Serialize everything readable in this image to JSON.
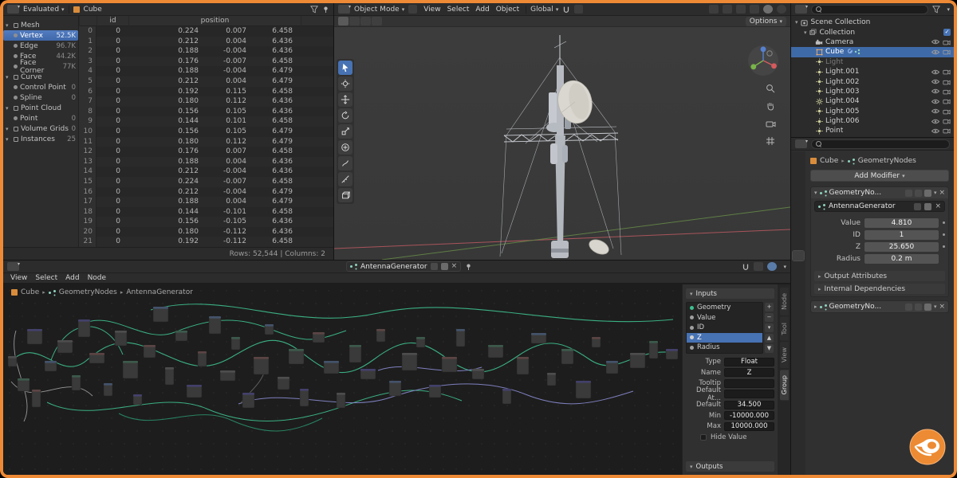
{
  "colors": {
    "accent_orange": "#ee8a35",
    "select_blue": "#4772b3",
    "wire_green": "#3ec08f",
    "wire_purple": "#8a8bd0"
  },
  "spreadsheet": {
    "header": {
      "dataset_label": "Evaluated",
      "object_label": "Cube"
    },
    "sidebar": [
      {
        "label": "Mesh",
        "count": "",
        "kind": "group"
      },
      {
        "label": "Vertex",
        "count": "52.5K",
        "kind": "item",
        "selected": true
      },
      {
        "label": "Edge",
        "count": "96.7K",
        "kind": "item"
      },
      {
        "label": "Face",
        "count": "44.2K",
        "kind": "item"
      },
      {
        "label": "Face Corner",
        "count": "77K",
        "kind": "item"
      },
      {
        "label": "Curve",
        "count": "",
        "kind": "group"
      },
      {
        "label": "Control Point",
        "count": "0",
        "kind": "item"
      },
      {
        "label": "Spline",
        "count": "0",
        "kind": "item"
      },
      {
        "label": "Point Cloud",
        "count": "",
        "kind": "group"
      },
      {
        "label": "Point",
        "count": "0",
        "kind": "item"
      },
      {
        "label": "Volume Grids",
        "count": "0",
        "kind": "group"
      },
      {
        "label": "Instances",
        "count": "25",
        "kind": "group"
      }
    ],
    "table": {
      "id_header": "id",
      "position_header": "position",
      "rows": [
        [
          "0",
          "0",
          "0.224",
          "0.007",
          "6.458"
        ],
        [
          "1",
          "0",
          "0.212",
          "0.004",
          "6.436"
        ],
        [
          "2",
          "0",
          "0.188",
          "-0.004",
          "6.436"
        ],
        [
          "3",
          "0",
          "0.176",
          "-0.007",
          "6.458"
        ],
        [
          "4",
          "0",
          "0.188",
          "-0.004",
          "6.479"
        ],
        [
          "5",
          "0",
          "0.212",
          "0.004",
          "6.479"
        ],
        [
          "6",
          "0",
          "0.192",
          "0.115",
          "6.458"
        ],
        [
          "7",
          "0",
          "0.180",
          "0.112",
          "6.436"
        ],
        [
          "8",
          "0",
          "0.156",
          "0.105",
          "6.436"
        ],
        [
          "9",
          "0",
          "0.144",
          "0.101",
          "6.458"
        ],
        [
          "10",
          "0",
          "0.156",
          "0.105",
          "6.479"
        ],
        [
          "11",
          "0",
          "0.180",
          "0.112",
          "6.479"
        ],
        [
          "12",
          "0",
          "0.176",
          "0.007",
          "6.458"
        ],
        [
          "13",
          "0",
          "0.188",
          "0.004",
          "6.436"
        ],
        [
          "14",
          "0",
          "0.212",
          "-0.004",
          "6.436"
        ],
        [
          "15",
          "0",
          "0.224",
          "-0.007",
          "6.458"
        ],
        [
          "16",
          "0",
          "0.212",
          "-0.004",
          "6.479"
        ],
        [
          "17",
          "0",
          "0.188",
          "0.004",
          "6.479"
        ],
        [
          "18",
          "0",
          "0.144",
          "-0.101",
          "6.458"
        ],
        [
          "19",
          "0",
          "0.156",
          "-0.105",
          "6.436"
        ],
        [
          "20",
          "0",
          "0.180",
          "-0.112",
          "6.436"
        ],
        [
          "21",
          "0",
          "0.192",
          "-0.112",
          "6.458"
        ]
      ]
    },
    "status": "Rows: 52,544  |  Columns: 2"
  },
  "viewport": {
    "mode": "Object Mode",
    "menus": [
      {
        "label": "View"
      },
      {
        "label": "Select"
      },
      {
        "label": "Add"
      },
      {
        "label": "Object"
      }
    ],
    "orientation": "Global",
    "options_label": "Options"
  },
  "outliner": {
    "rows": [
      {
        "label": "Scene Collection",
        "kind": "scene",
        "depth": "d0",
        "arrow": true
      },
      {
        "label": "Collection",
        "kind": "collection",
        "depth": "d1",
        "arrow": true,
        "check": true
      },
      {
        "label": "Camera",
        "kind": "camera",
        "depth": "d2",
        "vis": true
      },
      {
        "label": "Cube",
        "kind": "mesh",
        "depth": "d2",
        "vis": true,
        "mods": true,
        "selected": true
      },
      {
        "label": "Light",
        "kind": "light",
        "depth": "d2",
        "dim": true
      },
      {
        "label": "Light.001",
        "kind": "light",
        "depth": "d2",
        "vis": true
      },
      {
        "label": "Light.002",
        "kind": "light",
        "depth": "d2",
        "vis": true
      },
      {
        "label": "Light.003",
        "kind": "light",
        "depth": "d2",
        "vis": true
      },
      {
        "label": "Light.004",
        "kind": "sun",
        "depth": "d2",
        "vis": true
      },
      {
        "label": "Light.005",
        "kind": "light",
        "depth": "d2",
        "vis": true
      },
      {
        "label": "Light.006",
        "kind": "light",
        "depth": "d2",
        "vis": true
      },
      {
        "label": "Point",
        "kind": "light",
        "depth": "d2",
        "vis": true
      }
    ]
  },
  "properties": {
    "breadcrumb": {
      "object": "Cube",
      "modifier": "GeometryNodes"
    },
    "add_modifier_label": "Add Modifier",
    "modifier": {
      "name": "GeometryNo...",
      "node_group": "AntennaGenerator",
      "fields": [
        {
          "label": "Value",
          "value": "4.810",
          "dot": true
        },
        {
          "label": "ID",
          "value": "1",
          "dot": true
        },
        {
          "label": "Z",
          "value": "25.650",
          "dot": true
        },
        {
          "label": "Radius",
          "value": "0.2 m"
        }
      ],
      "sections": [
        {
          "label": "Output Attributes"
        },
        {
          "label": "Internal Dependencies"
        }
      ]
    },
    "modifier2_name": "GeometryNo...",
    "tabs": [
      {
        "name": "tool",
        "color": "#9a9a9a"
      },
      {
        "name": "render",
        "color": "#9a9a9a"
      },
      {
        "name": "output",
        "color": "#9a9a9a"
      },
      {
        "name": "view-layer",
        "color": "#9a9a9a"
      },
      {
        "name": "scene",
        "color": "#c9c9c9"
      },
      {
        "name": "world",
        "color": "#9a9a9a"
      },
      {
        "name": "object",
        "color": "#e8832a"
      },
      {
        "name": "modifiers",
        "color": "#7da7dd",
        "active": true
      },
      {
        "name": "particles",
        "color": "#9a9a9a"
      },
      {
        "name": "physics",
        "color": "#9a9a9a"
      },
      {
        "name": "constraints",
        "color": "#9a9a9a"
      },
      {
        "name": "object-data",
        "color": "#7dc87d"
      },
      {
        "name": "material",
        "color": "#c87d7d"
      },
      {
        "name": "texture",
        "color": "#9a9a9a"
      }
    ]
  },
  "node_editor": {
    "menus": [
      {
        "label": "View"
      },
      {
        "label": "Select"
      },
      {
        "label": "Add"
      },
      {
        "label": "Node"
      }
    ],
    "datablock": "AntennaGenerator",
    "breadcrumb": {
      "object": "Cube",
      "modifier": "GeometryNodes",
      "group": "AntennaGenerator"
    },
    "sidebar_tabs": [
      {
        "label": "Node"
      },
      {
        "label": "Tool"
      },
      {
        "label": "View"
      },
      {
        "label": "Group",
        "active": true
      }
    ],
    "npanel": {
      "inputs_label": "Inputs",
      "outputs_label": "Outputs",
      "sockets": [
        {
          "label": "Geometry",
          "c": "#3ec08f"
        },
        {
          "label": "Value",
          "c": "#9f9f9f"
        },
        {
          "label": "ID",
          "c": "#9f9f9f"
        },
        {
          "label": "Z",
          "c": "#cfcfcf",
          "selected": true
        },
        {
          "label": "Radius",
          "c": "#9f9f9f"
        }
      ],
      "fields": [
        {
          "label": "Type",
          "value": "Float",
          "kind": "drop"
        },
        {
          "label": "Name",
          "value": "Z",
          "kind": "left"
        },
        {
          "label": "Tooltip",
          "value": "",
          "kind": "left"
        },
        {
          "label": "Default At...",
          "value": "",
          "kind": "left"
        },
        {
          "label": "Default",
          "value": "34.500"
        },
        {
          "label": "Min",
          "value": "-10000.000"
        },
        {
          "label": "Max",
          "value": "10000.000"
        }
      ],
      "hide_value_label": "Hide Value"
    }
  }
}
